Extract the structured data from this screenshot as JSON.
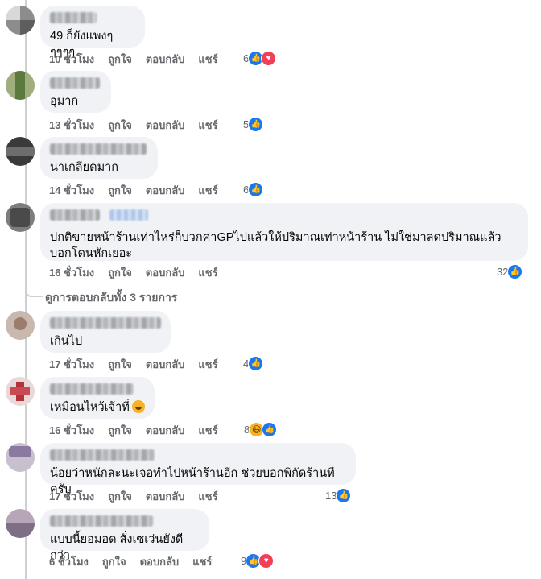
{
  "actions": {
    "like": "ถูกใจ",
    "reply": "ตอบกลับ",
    "share": "แชร์"
  },
  "comments": [
    {
      "text": "49 ก็ยังแพงๆๆๆๆๆ",
      "time": "10 ชั่วโมง",
      "reaction_count": "6",
      "reactions": [
        "like-icon",
        "love-icon"
      ]
    },
    {
      "text": "อุมาก",
      "time": "13 ชั่วโมง",
      "reaction_count": "5",
      "reactions": [
        "like-icon"
      ]
    },
    {
      "text": "น่าเกลียดมาก",
      "time": "14 ชั่วโมง",
      "reaction_count": "6",
      "reactions": [
        "like-icon"
      ]
    },
    {
      "text": "ปกติขายหน้าร้านเท่าไหร่ก็บวกค่าGPไปแล้วให้ปริมาณเท่าหน้าร้าน ไม่ใช่มาลดปริมาณแล้วบอกโดนหักเยอะ",
      "time": "16 ชั่วโมง",
      "reaction_count": "32",
      "reactions": [
        "like-icon"
      ]
    },
    {
      "text": "เกินไป",
      "time": "17 ชั่วโมง",
      "reaction_count": "4",
      "reactions": [
        "like-icon"
      ]
    },
    {
      "text": "เหมือนไหว้เจ้าที่",
      "time": "16 ชั่วโมง",
      "reaction_count": "8",
      "reactions": [
        "haha-icon",
        "like-icon"
      ]
    },
    {
      "text": "น้อยว่าหนักละนะเจอทำไปหน้าร้านอีก ช่วยบอกพิกัดร้านทีครับ",
      "time": "17 ชั่วโมง",
      "reaction_count": "13",
      "reactions": [
        "like-icon"
      ]
    },
    {
      "text": "แบบนี้ยอมอด สั่งเซเว่นยังดีกว่า",
      "time": "6 ชั่วโมง",
      "reaction_count": "9",
      "reactions": [
        "like-icon",
        "love-icon"
      ]
    }
  ],
  "view_replies": "ดูการตอบกลับทั้ง 3 รายการ",
  "colors": {
    "like": "#1877f2",
    "love": "#f33e58",
    "haha": "#f7b125",
    "bubble": "#f0f2f5",
    "meta": "#65676b"
  }
}
